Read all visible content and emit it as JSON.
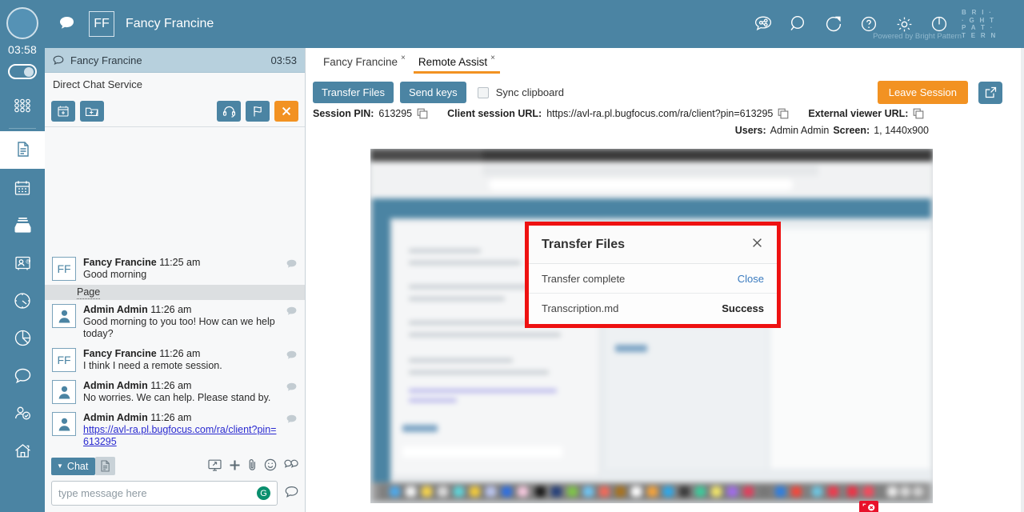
{
  "rail": {
    "timer": "03:58",
    "items": [
      {
        "name": "keypad-icon",
        "label": "Keypad"
      },
      {
        "name": "documents-icon",
        "label": "Cases",
        "active": true
      },
      {
        "name": "calendar-icon",
        "label": "Calendar"
      },
      {
        "name": "inbox-icon",
        "label": "Inbox"
      },
      {
        "name": "contact-card-icon",
        "label": "Contacts"
      },
      {
        "name": "gauge-icon",
        "label": "Dashboard"
      },
      {
        "name": "pie-chart-icon",
        "label": "Reports"
      },
      {
        "name": "chat-bubble-icon",
        "label": "Chat"
      },
      {
        "name": "agent-status-icon",
        "label": "My Status"
      },
      {
        "name": "home-icon",
        "label": "Home"
      }
    ]
  },
  "topbar": {
    "initials": "FF",
    "title": "Fancy Francine",
    "icons": [
      {
        "name": "share-chat-icon"
      },
      {
        "name": "search-icon"
      },
      {
        "name": "transfer-icon"
      },
      {
        "name": "help-icon"
      },
      {
        "name": "settings-gear-icon"
      },
      {
        "name": "power-icon"
      }
    ],
    "powered_by": "Powered by Bright Pattern",
    "brand_lines": [
      "B R I ·",
      "· G H T",
      "P A T ·",
      "T E R N"
    ]
  },
  "chat_panel": {
    "header_name": "Fancy Francine",
    "header_time": "03:53",
    "service": "Direct Chat Service",
    "tools": [
      {
        "name": "schedule-followup-button",
        "label": "Schedule"
      },
      {
        "name": "add-case-folder-button",
        "label": "Add to case"
      },
      {
        "name": "headset-button",
        "label": "Voice"
      },
      {
        "name": "flag-button",
        "label": "Flag"
      },
      {
        "name": "end-chat-button",
        "label": "End"
      }
    ],
    "page_divider": "Page",
    "messages": [
      {
        "avatar": "FF",
        "avatar_type": "initials",
        "author": "Fancy Francine",
        "time": "11:25 am",
        "text": "Good morning",
        "link": ""
      },
      {
        "avatar": "",
        "avatar_type": "person",
        "author": "Admin Admin",
        "time": "11:26 am",
        "text": "Good morning to you too! How can we help today?",
        "link": ""
      },
      {
        "avatar": "FF",
        "avatar_type": "initials",
        "author": "Fancy Francine",
        "time": "11:26 am",
        "text": "I think I need a remote session.",
        "link": ""
      },
      {
        "avatar": "",
        "avatar_type": "person",
        "author": "Admin Admin",
        "time": "11:26 am",
        "text": "No worries. We can help. Please stand by.",
        "link": ""
      },
      {
        "avatar": "",
        "avatar_type": "person",
        "author": "Admin Admin",
        "time": "11:26 am",
        "text": "",
        "link": "https://avl-ra.pl.bugfocus.com/ra/client?pin=613295"
      }
    ],
    "footer": {
      "chat_button": "Chat",
      "doc_icon": "document-icon",
      "icons": [
        {
          "name": "screen-share-icon"
        },
        {
          "name": "plus-icon"
        },
        {
          "name": "attachment-icon"
        },
        {
          "name": "emoji-icon"
        },
        {
          "name": "quick-replies-icon"
        }
      ],
      "input_placeholder": "type message here",
      "grammar_badge": "G",
      "send_icon": "send-bubble-icon"
    }
  },
  "main": {
    "tabs": [
      {
        "label": "Fancy Francine",
        "close": "×",
        "active": false
      },
      {
        "label": "Remote Assist",
        "close": "×",
        "active": true
      }
    ],
    "toolbar": {
      "transfer_files": "Transfer Files",
      "send_keys": "Send keys",
      "sync_clipboard": "Sync clipboard",
      "sync_clipboard_checked": false,
      "leave_session": "Leave Session",
      "popout_icon": "popout-window-icon"
    },
    "session": {
      "pin_label": "Session PIN:",
      "pin_value": "613295",
      "client_url_label": "Client session URL:",
      "client_url_value": "https://avl-ra.pl.bugfocus.com/ra/client?pin=613295",
      "external_url_label": "External viewer URL:",
      "copy_icon": "copy-icon"
    },
    "status": {
      "users_label": "Users:",
      "users_value": "Admin Admin",
      "screen_label": "Screen:",
      "screen_value": "1, 1440x900"
    }
  },
  "remote_modal": {
    "title": "Transfer Files",
    "close_icon": "close-icon",
    "status_text": "Transfer complete",
    "close_link": "Close",
    "file_name": "Transcription.md",
    "file_status": "Success",
    "highlight_color": "#ee1111"
  },
  "colors": {
    "brand_blue": "#4b84a3",
    "accent_orange": "#f29222",
    "chat_header": "#b7d0dd",
    "link_blue": "#2a2ad0",
    "modal_link": "#3a7bbf"
  }
}
